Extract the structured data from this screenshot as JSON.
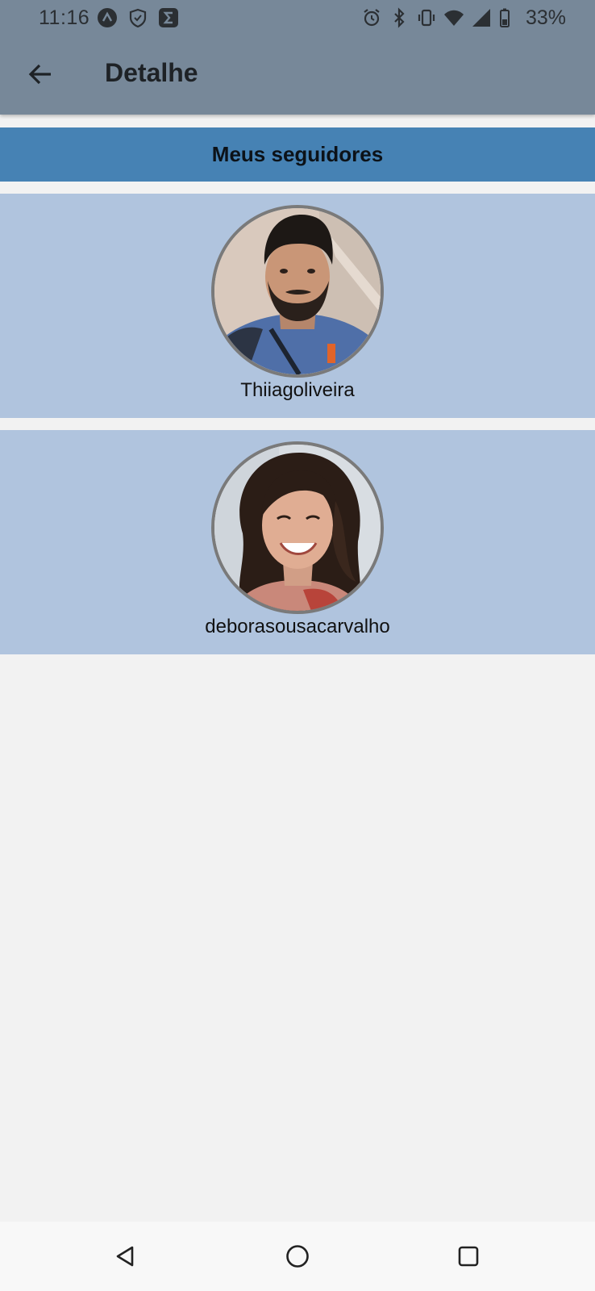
{
  "status_bar": {
    "time": "11:16",
    "battery": "33%",
    "left_icons": [
      "app-a-icon",
      "shield-icon",
      "sigma-icon"
    ],
    "right_icons": [
      "alarm-icon",
      "bluetooth-icon",
      "vibrate-icon",
      "wifi-icon",
      "signal-icon",
      "battery-icon"
    ]
  },
  "app_bar": {
    "title": "Detalhe",
    "back_icon": "arrow-left-icon",
    "color": "#778899"
  },
  "section": {
    "title": "Meus seguidores",
    "color": "#4682b4"
  },
  "followers": [
    {
      "username": "Thiiagoliveira",
      "avatar": "male-avatar"
    },
    {
      "username": "deborasousacarvalho",
      "avatar": "female-avatar"
    }
  ],
  "card_color": "#b0c4de",
  "nav_bar": {
    "buttons": [
      "nav-back-icon",
      "nav-home-icon",
      "nav-recents-icon"
    ]
  }
}
